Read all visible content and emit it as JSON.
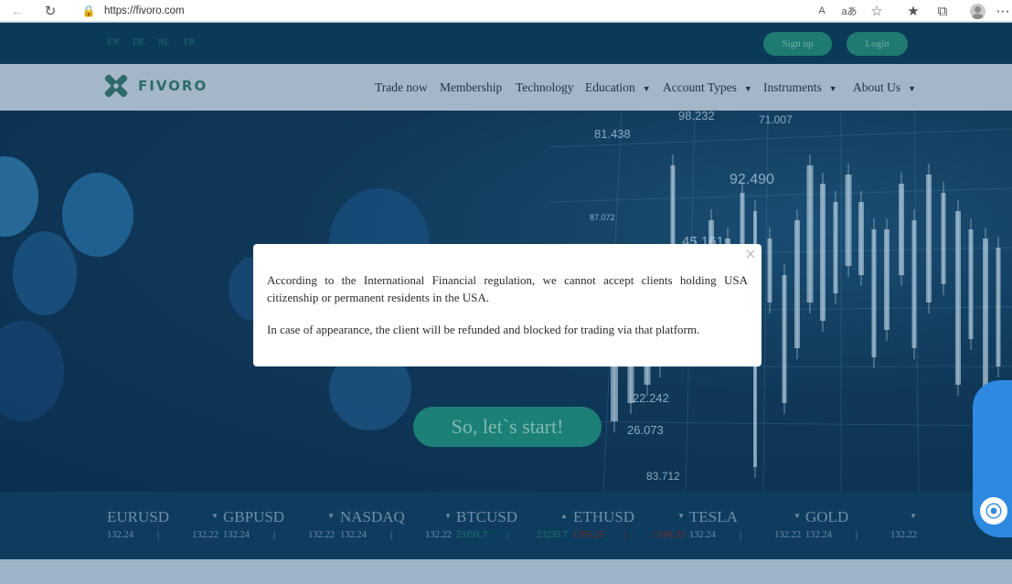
{
  "browser": {
    "url": "https://fivoro.com",
    "read_aloud_label": "A",
    "translate_label": "aあ"
  },
  "topbar": {
    "languages": [
      "EN",
      "DE",
      "NL",
      "FR"
    ],
    "signup_label": "Sign up",
    "login_label": "Login"
  },
  "nav": {
    "logo_text": "FIVORO",
    "items": [
      {
        "label": "Trade now"
      },
      {
        "label": "Membership"
      },
      {
        "label": "Technology"
      },
      {
        "label": "Education",
        "dropdown": true
      },
      {
        "label": "Account Types",
        "dropdown": true
      },
      {
        "label": "Instruments",
        "dropdown": true
      },
      {
        "label": "About Us",
        "dropdown": true
      }
    ]
  },
  "hero": {
    "cta_label": "So, let`s start!",
    "bg_numbers": [
      "81.438",
      "98.232",
      "71.007",
      "92.490",
      "87.072",
      "45.161",
      "22.242",
      "26.073",
      "83.712"
    ]
  },
  "ticker": [
    {
      "symbol": "EURUSD",
      "v1": "132.24",
      "v2": "132.22",
      "trend": "down-arrow",
      "state": "neutral"
    },
    {
      "symbol": "GBPUSD",
      "v1": "132.24",
      "v2": "132.22",
      "trend": "down-arrow",
      "state": "neutral"
    },
    {
      "symbol": "NASDAQ",
      "v1": "132.24",
      "v2": "132.22",
      "trend": "down-arrow",
      "state": "neutral"
    },
    {
      "symbol": "BTCUSD",
      "v1": "23191.7",
      "v2": "23235.7",
      "trend": "up-arrow",
      "state": "up"
    },
    {
      "symbol": "ETHUSD",
      "v1": "1595.25",
      "v2": "1596.33",
      "trend": "down-arrow",
      "state": "down"
    },
    {
      "symbol": "TESLA",
      "v1": "132.24",
      "v2": "132.22",
      "trend": "down-arrow",
      "state": "neutral"
    },
    {
      "symbol": "GOLD",
      "v1": "132.24",
      "v2": "132.22",
      "trend": "down-arrow",
      "state": "neutral"
    }
  ],
  "modal": {
    "paragraph1": "According to the International Financial regulation, we cannot accept clients holding USA citizenship or permanent residents in the USA.",
    "paragraph2": "In case of appearance, the client will be refunded and blocked for trading via that platform.",
    "close_symbol": "×"
  },
  "colors": {
    "topbar_bg": "#0b3a58",
    "nav_bg": "#a4b7c9",
    "accent_green": "#1f7a72",
    "ticker_bg": "#0e3c5e",
    "chat_blue": "#2e89e0"
  },
  "icons": {
    "browser": [
      "back-icon",
      "reload-icon",
      "lock-icon",
      "favorite-add-icon",
      "favorites-icon",
      "collections-icon",
      "profile-icon",
      "more-icon"
    ],
    "chat": "chat-icon",
    "modal": "close-icon"
  }
}
